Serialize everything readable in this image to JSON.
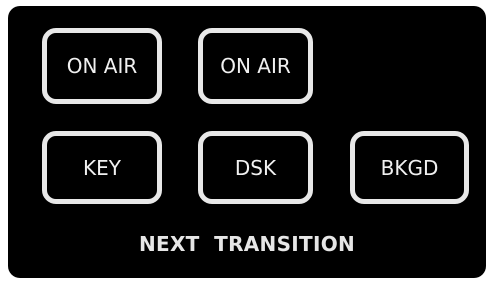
{
  "buttons": {
    "on_air_1": "ON AIR",
    "on_air_2": "ON AIR",
    "key": "KEY",
    "dsk": "DSK",
    "bkgd": "BKGD"
  },
  "footer": {
    "label": "NEXT  TRANSITION"
  },
  "colors": {
    "panel_background": "#000000",
    "button_border": "#e8e8e8",
    "text": "#f0f0f0"
  }
}
